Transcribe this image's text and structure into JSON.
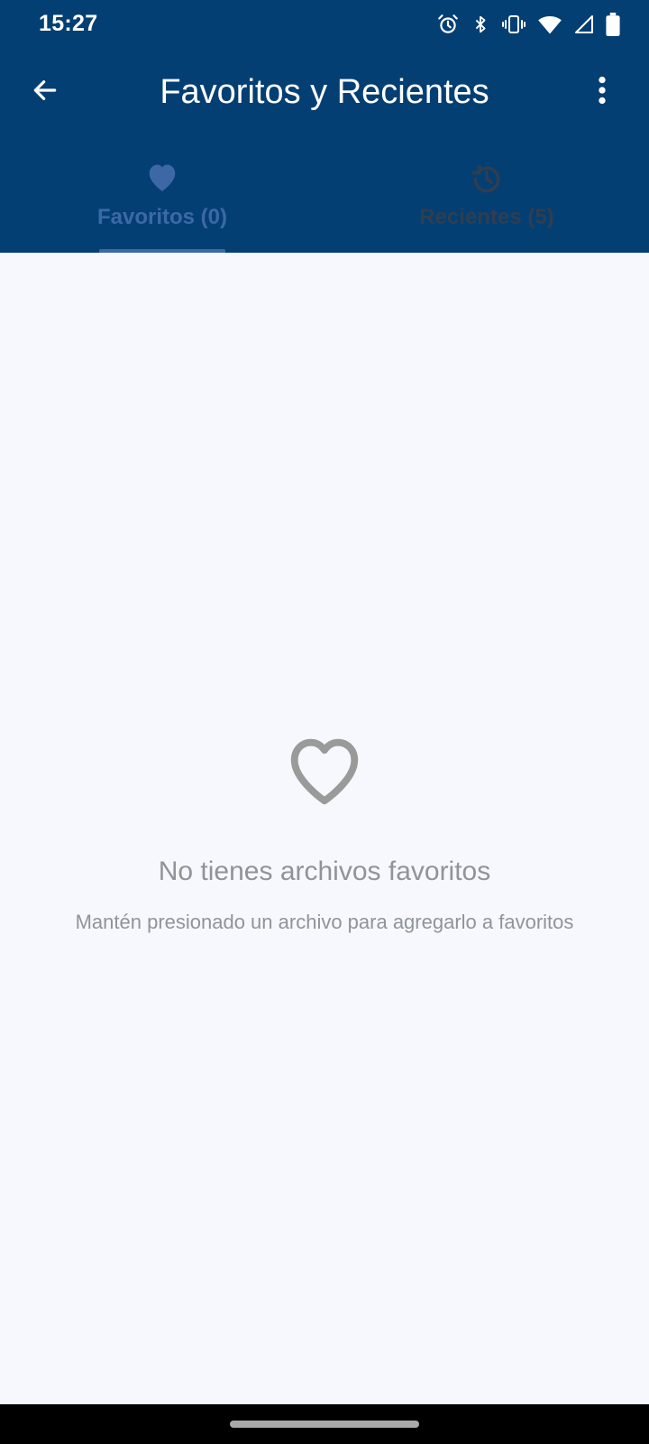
{
  "status_bar": {
    "time": "15:27",
    "icons": [
      "alarm-icon",
      "bluetooth-icon",
      "vibrate-icon",
      "wifi-icon",
      "signal-icon",
      "battery-icon"
    ]
  },
  "app_bar": {
    "title": "Favoritos y Recientes",
    "back_icon": "arrow-back-icon",
    "menu_icon": "more-vert-icon"
  },
  "tabs": [
    {
      "label": "Favoritos (0)",
      "icon": "heart-icon",
      "selected": true
    },
    {
      "label": "Recientes (5)",
      "icon": "history-icon",
      "selected": false
    }
  ],
  "empty_state": {
    "icon": "heart-outline-icon",
    "title": "No tienes archivos favoritos",
    "subtitle": "Mantén presionado un archivo para agregarlo a favoritos"
  },
  "colors": {
    "header_background": "#043f73",
    "selected_tab": "#3c69a6",
    "unselected_tab": "#2f3e50",
    "content_background": "#f6f8fd",
    "muted_text": "#8f9499"
  }
}
